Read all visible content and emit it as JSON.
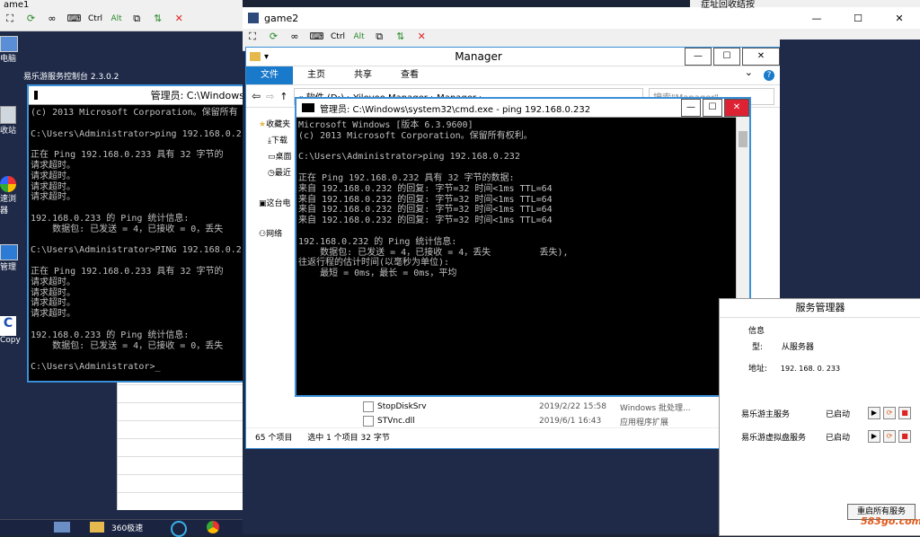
{
  "game1": {
    "title": "ame1",
    "toolbar_ctrl": "Ctrl",
    "toolbar_alt": "Alt"
  },
  "game2": {
    "title": "game2",
    "toolbar_ctrl": "Ctrl",
    "toolbar_alt": "Alt"
  },
  "desktop": {
    "icons": [
      "电脑",
      "收站",
      "速浏\n器",
      "管理",
      "Copy"
    ],
    "right_header": "症址回收结按",
    "taskbar_label": "360极速"
  },
  "console_app": {
    "title": "易乐游服务控制台 2.3.0.2"
  },
  "cmd1": {
    "title": "管理员: C:\\Windows",
    "lines": "(c) 2013 Microsoft Corporation。保留所有\n\nC:\\Users\\Administrator>ping 192.168.0.2\n\n正在 Ping 192.168.0.233 具有 32 字节的\n请求超时。\n请求超时。\n请求超时。\n请求超时。\n\n192.168.0.233 的 Ping 统计信息:\n    数据包: 已发送 = 4，已接收 = 0，丢失\n\nC:\\Users\\Administrator>PING 192.168.0.2\n\n正在 Ping 192.168.0.233 具有 32 字节的\n请求超时。\n请求超时。\n请求超时。\n请求超时。\n\n192.168.0.233 的 Ping 统计信息:\n    数据包: 已发送 = 4，已接收 = 0，丢失\n\nC:\\Users\\Administrator>_"
  },
  "explorer": {
    "title": "Manager",
    "tabs": [
      "文件",
      "主页",
      "共享",
      "查看"
    ],
    "breadcrumb": "« 软件 (D:) › Yileyoo Manager › Manager ›",
    "search_placeholder": "搜索\"Manager\"",
    "sidebar": [
      "收藏夹",
      "下载",
      "桌面",
      "最近",
      "这台电",
      "网络"
    ],
    "files": [
      {
        "name": "StopDiskSrv",
        "date": "2019/2/22 15:58",
        "type": "Windows 批处理..."
      },
      {
        "name": "STVnc.dll",
        "date": "2019/6/1 16:43",
        "type": "应用程序扩展"
      }
    ],
    "status_count": "65 个项目",
    "status_selected": "选中 1 个项目 32 字节"
  },
  "cmd2": {
    "title": "管理员: C:\\Windows\\system32\\cmd.exe - ping 192.168.0.232",
    "lines": "Microsoft Windows [版本 6.3.9600]\n(c) 2013 Microsoft Corporation。保留所有权利。\n\nC:\\Users\\Administrator>ping 192.168.0.232\n\n正在 Ping 192.168.0.232 具有 32 字节的数据:\n来自 192.168.0.232 的回复: 字节=32 时间<1ms TTL=64\n来自 192.168.0.232 的回复: 字节=32 时间<1ms TTL=64\n来自 192.168.0.232 的回复: 字节=32 时间<1ms TTL=64\n来自 192.168.0.232 的回复: 字节=32 时间<1ms TTL=64\n\n192.168.0.232 的 Ping 统计信息:\n    数据包: 已发送 = 4，已接收 = 4，丢失         丢失),\n往返行程的估计时间(以毫秒为单位):\n    最短 = 0ms，最长 = 0ms，平均"
  },
  "service_mgr": {
    "title": "服务管理器",
    "info_header": "信息",
    "type_label": "型:",
    "type_value": "从服务器",
    "addr_label": "地址:",
    "addr_value": "192. 168. 0. 233",
    "services": [
      {
        "name": "易乐游主服务",
        "status": "已启动"
      },
      {
        "name": "易乐游虚拟盘服务",
        "status": "已启动"
      }
    ],
    "restart_button": "重启所有服务"
  },
  "watermark": "583go.com"
}
